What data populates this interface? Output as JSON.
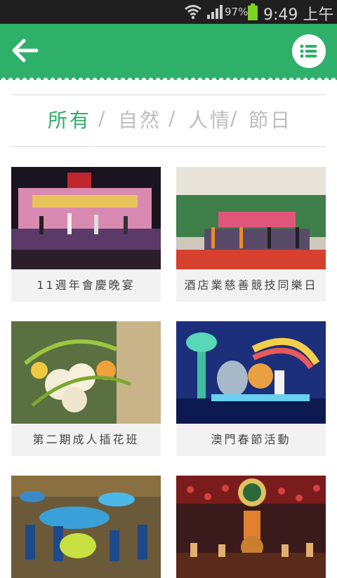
{
  "status_bar": {
    "battery_percent": "97%",
    "time": "9:49 上午"
  },
  "app_bar": {
    "back_icon": "arrow-left-icon",
    "menu_icon": "list-icon",
    "accent": "#2fb06a"
  },
  "tabs": [
    {
      "label": "所有",
      "active": true
    },
    {
      "label": "自然",
      "active": false
    },
    {
      "label": "人情",
      "active": false
    },
    {
      "label": "節日",
      "active": false
    }
  ],
  "tab_separator": "/",
  "cards": [
    {
      "caption": "11週年會慶晚宴",
      "image": "stage-banquet-photo"
    },
    {
      "caption": "酒店業慈善競技同樂日",
      "image": "group-stage-photo"
    },
    {
      "caption": "第二期成人插花班",
      "image": "flower-arrangement-photo"
    },
    {
      "caption": "澳門春節活動",
      "image": "festival-float-photo"
    },
    {
      "caption": "",
      "image": "decorated-hall-photo"
    },
    {
      "caption": "",
      "image": "theatre-performance-photo"
    }
  ]
}
